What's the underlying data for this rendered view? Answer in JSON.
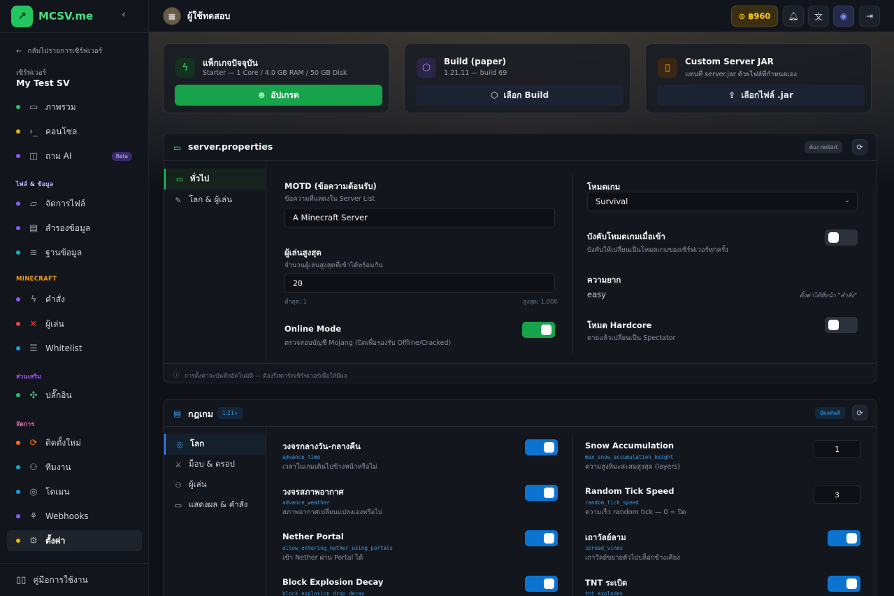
{
  "brand": {
    "name": "MCSV.me"
  },
  "sidebar": {
    "back_label": "กลับไปรายการเซิร์ฟเวอร์",
    "server_label": "เซิร์ฟเวอร์",
    "server_name": "My Test SV",
    "groups": {
      "files": "ไฟล์ & ข้อมูล",
      "minecraft": "MINECRAFT",
      "extras": "ส่วนเสริม",
      "manage": "จัดการ"
    },
    "items": [
      {
        "label": "ภาพรวม",
        "dot": "#22c55e",
        "icon": "monitor-icon"
      },
      {
        "label": "คอนโซล",
        "dot": "#eab308",
        "icon": "terminal-icon"
      },
      {
        "label": "ถาม AI",
        "dot": "#8b5cf6",
        "icon": "bot-icon",
        "badge": "Beta"
      },
      {
        "label": "จัดการไฟล์",
        "dot": "#8b5cf6",
        "icon": "folder-icon"
      },
      {
        "label": "สำรองข้อมูล",
        "dot": "#8b5cf6",
        "icon": "archive-icon"
      },
      {
        "label": "ฐานข้อมูล",
        "dot": "#06b6d4",
        "icon": "database-icon"
      },
      {
        "label": "คำสั่ง",
        "dot": "#8b5cf6",
        "icon": "bolt-icon"
      },
      {
        "label": "ผู้เล่น",
        "dot": "#ef4444",
        "icon": "swords-icon"
      },
      {
        "label": "Whitelist",
        "dot": "#0ea5e9",
        "icon": "list-check-icon"
      },
      {
        "label": "ปลั๊กอิน",
        "dot": "#22c55e",
        "icon": "puzzle-icon"
      },
      {
        "label": "ติดตั้งใหม่",
        "dot": "#f97316",
        "icon": "reinstall-icon"
      },
      {
        "label": "ทีมงาน",
        "dot": "#06b6d4",
        "icon": "users-icon"
      },
      {
        "label": "โดเมน",
        "dot": "#0ea5e9",
        "icon": "globe-icon"
      },
      {
        "label": "Webhooks",
        "dot": "#8b5cf6",
        "icon": "webhook-icon"
      },
      {
        "label": "ตั้งค่า",
        "dot": "#eab308",
        "icon": "gear-icon",
        "active": true
      }
    ],
    "manual": "คู่มือการใช้งาน"
  },
  "topbar": {
    "username": "ผู้ใช้ทดสอบ",
    "coins": "฿960"
  },
  "cards": [
    {
      "title": "แพ็กเกจปัจจุบัน",
      "subtitle": "Starter — 1 Core / 4.0 GB RAM / 50 GB Disk",
      "button": "อัปเกรด"
    },
    {
      "title": "Build (paper)",
      "subtitle": "1.21.11 — build 69",
      "button": "เลือก Build"
    },
    {
      "title": "Custom Server JAR",
      "subtitle": "แทนที่ server.jar ด้วยไฟล์ที่กำหนดเอง",
      "button": "เลือกไฟล์ .jar"
    }
  ],
  "props": {
    "title": "server.properties",
    "badge": "ต้อง restart",
    "tabs": [
      "ทั่วไป",
      "โลก & ผู้เล่น"
    ],
    "motd": {
      "label": "MOTD (ข้อความต้อนรับ)",
      "desc": "ข้อความที่แสดงใน Server List",
      "value": "A Minecraft Server"
    },
    "max_players": {
      "label": "ผู้เล่นสูงสุด",
      "desc": "จำนวนผู้เล่นสูงสุดที่เข้าได้พร้อมกัน",
      "value": "20",
      "min": "ต่ำสุด: 1",
      "max": "สูงสุด: 1,000"
    },
    "online_mode": {
      "label": "Online Mode",
      "desc": "ตรวจสอบบัญชี Mojang (ปิดเพื่อรองรับ Offline/Cracked)"
    },
    "gamemode": {
      "label": "โหมดเกม",
      "value": "Survival"
    },
    "force_gamemode": {
      "label": "บังคับโหมดเกมเมื่อเข้า",
      "desc": "บังคับให้เปลี่ยนเป็นโหมดเกมของเซิร์ฟเวอร์ทุกครั้ง"
    },
    "difficulty": {
      "label": "ความยาก",
      "value": "easy",
      "hint": "ตั้งค่าได้ที่หน้า \"คำสั่ง\""
    },
    "hardcore": {
      "label": "โหมด Hardcore",
      "desc": "ตายแล้วเปลี่ยนเป็น Spectator"
    },
    "footer": "การตั้งค่าจะบันทึกอัตโนมัติ — ต้องรีสตาร์ทเซิร์ฟเวอร์เพื่อให้มีผล"
  },
  "rules": {
    "title": "กฎเกม",
    "version": "1.21+",
    "badge": "มีผลทันที",
    "tabs": [
      "โลก",
      "ม็อบ & ดรอป",
      "ผู้เล่น",
      "แสดงผล & คำสั่ง"
    ],
    "left": [
      {
        "label": "วงจรกลางวัน-กลางคืน",
        "code": "advance_time",
        "desc": "เวลาในเกมเดินไปข้างหน้าหรือไม่"
      },
      {
        "label": "วงจรสภาพอากาศ",
        "code": "advance_weather",
        "desc": "สภาพอากาศเปลี่ยนแปลงเองหรือไม่"
      },
      {
        "label": "Nether Portal",
        "code": "allow_entering_nether_using_portals",
        "desc": "เข้า Nether ผ่าน Portal ได้"
      },
      {
        "label": "Block Explosion Decay",
        "code": "block_explosion_drop_decay",
        "desc": ""
      }
    ],
    "right": [
      {
        "label": "Snow Accumulation",
        "code": "max_snow_accumulation_height",
        "desc": "ความสูงหิมะสะสมสูงสุด (layers)",
        "value": "1"
      },
      {
        "label": "Random Tick Speed",
        "code": "random_tick_speed",
        "desc": "ความเร็ว random tick — 0 = ปิด",
        "value": "3"
      },
      {
        "label": "เถาวัลย์ลาม",
        "code": "spread_vines",
        "desc": "เถาวัลย์ขยายตัวไปบล็อกข้างเคียง"
      },
      {
        "label": "TNT ระเบิด",
        "code": "tnt_explodes",
        "desc": ""
      }
    ]
  }
}
